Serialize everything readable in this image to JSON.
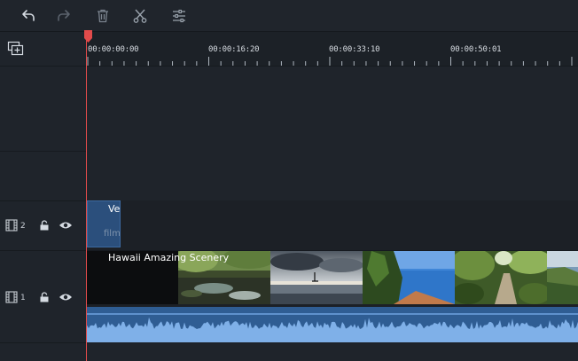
{
  "toolbar": {
    "undo_icon": "undo-icon",
    "redo_icon": "redo-icon",
    "delete_icon": "trash-icon",
    "cut_icon": "scissors-icon",
    "adjust_icon": "sliders-icon"
  },
  "ruler": {
    "timecodes": [
      "00:00:00:00",
      "00:00:16:20",
      "00:00:33:10",
      "00:00:50:01"
    ]
  },
  "tracks": {
    "track2": {
      "number": "2",
      "clip_title": "Ve",
      "clip_sub": "film"
    },
    "track1": {
      "number": "1",
      "clip_title": "Hawaii Amazing Scenery"
    }
  },
  "colors": {
    "playhead": "#e24b4b",
    "accent": "#2f5d93"
  }
}
